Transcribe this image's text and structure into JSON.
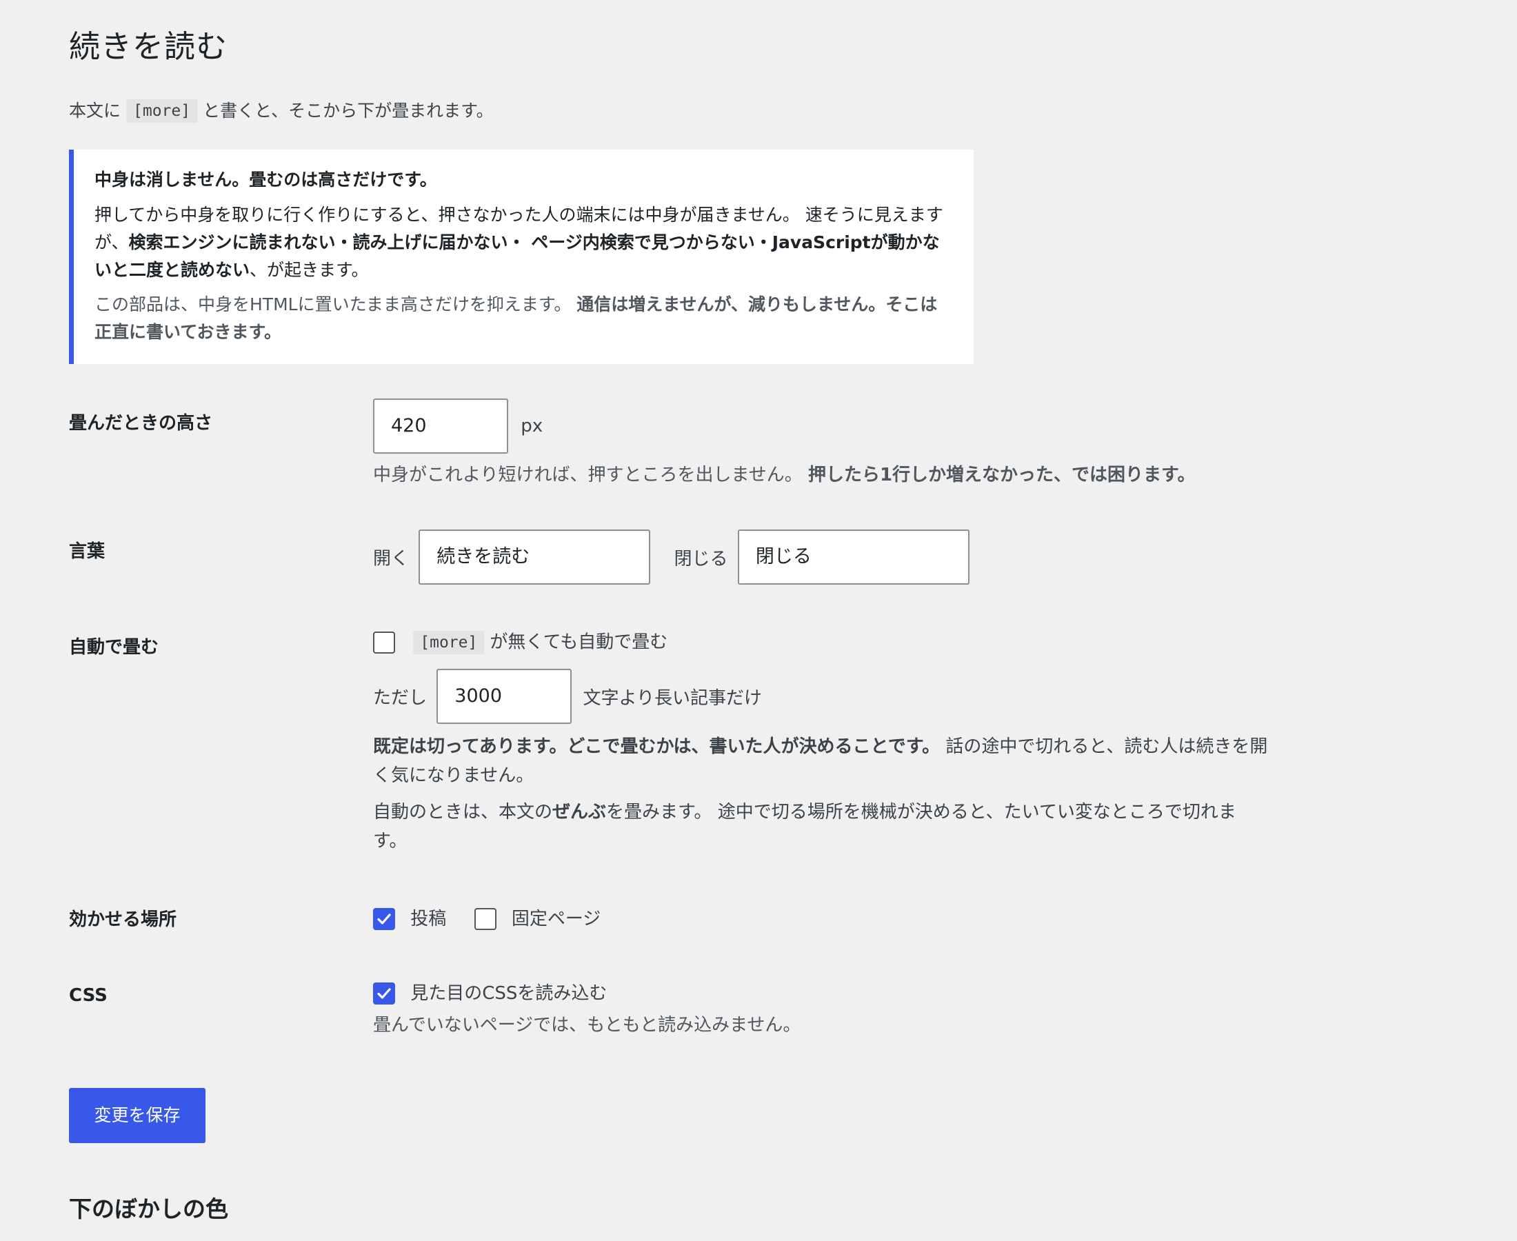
{
  "page": {
    "title": "続きを読む",
    "intro_before": "本文に",
    "intro_code": "[more]",
    "intro_after": "と書くと、そこから下が畳まれます。"
  },
  "notice": {
    "headline": "中身は消しません。畳むのは高さだけです。",
    "p1_a": "押してから中身を取りに行く作りにすると、押さなかった人の端末には中身が届きません。 速そうに見えますが、",
    "p1_bold": "検索エンジンに読まれない・読み上げに届かない・ ページ内検索で見つからない・JavaScriptが動かないと二度と読めない",
    "p1_b": "、が起きます。",
    "p2_a": "この部品は、中身をHTMLに置いたまま高さだけを抑えます。 ",
    "p2_bold": "通信は増えませんが、減りもしません。そこは正直に書いておきます。"
  },
  "height_setting": {
    "label": "畳んだときの高さ",
    "value": "420",
    "unit": "px",
    "desc_a": "中身がこれより短ければ、押すところを出しません。 ",
    "desc_bold": "押したら1行しか増えなかった、では困ります。"
  },
  "words_setting": {
    "label": "言葉",
    "open_label": "開く",
    "open_value": "続きを読む",
    "close_label": "閉じる",
    "close_value": "閉じる"
  },
  "auto_fold": {
    "label": "自動で畳む",
    "checkbox_code": "[more]",
    "checkbox_label": "が無くても自動で畳む",
    "checked": false,
    "only_prefix": "ただし",
    "min_chars": "3000",
    "only_suffix": "文字より長い記事だけ",
    "desc1_bold": "既定は切ってあります。どこで畳むかは、書いた人が決めることです。",
    "desc1_rest": " 話の途中で切れると、読む人は続きを開く気になりません。",
    "desc2_a": "自動のときは、本文の",
    "desc2_bold": "ぜんぶ",
    "desc2_b": "を畳みます。 途中で切る場所を機械が決めると、たいてい変なところで切れます。"
  },
  "apply_to": {
    "label": "効かせる場所",
    "posts_label": "投稿",
    "posts_checked": true,
    "pages_label": "固定ページ",
    "pages_checked": false
  },
  "css_setting": {
    "label": "CSS",
    "checkbox_label": "見た目のCSSを読み込む",
    "checked": true,
    "desc": "畳んでいないページでは、もともと読み込みません。"
  },
  "save_button": "変更を保存",
  "next_section_title": "下のぼかしの色",
  "colors": {
    "accent": "#3858e9",
    "background": "#f0f0f1"
  }
}
